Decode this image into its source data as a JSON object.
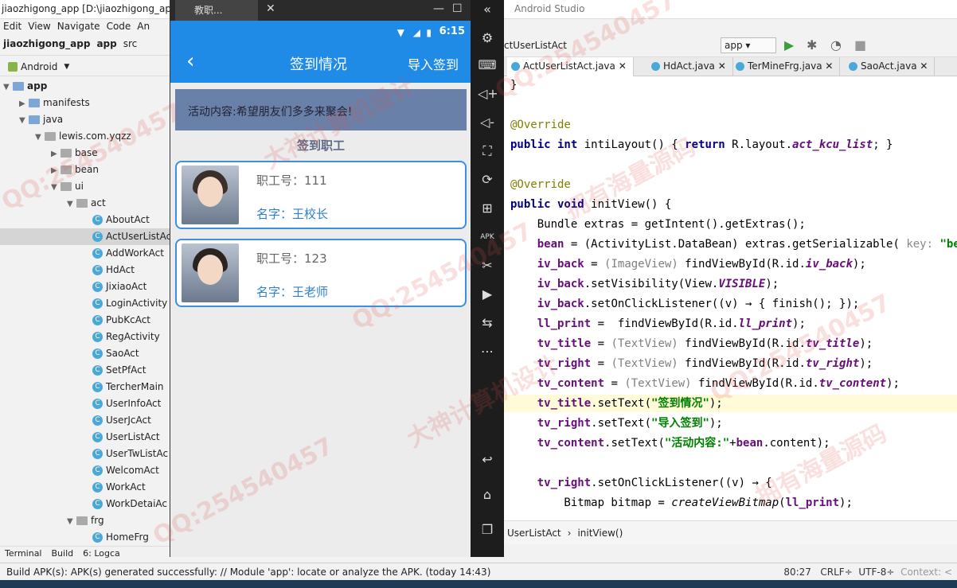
{
  "window": {
    "project_title": "jiaozhigong_app [D:\\jiaozhigong_app]",
    "studio_title": "Android Studio"
  },
  "menu": [
    "Edit",
    "View",
    "Navigate",
    "Code",
    "An"
  ],
  "breadcrumb": [
    "jiaozhigong_app",
    "app",
    "src"
  ],
  "project_view": {
    "mode": "Android"
  },
  "tree": [
    {
      "label": "app",
      "indent": 0,
      "kind": "folder-bold",
      "arrow": "▼"
    },
    {
      "label": "manifests",
      "indent": 1,
      "kind": "folder",
      "arrow": "▶"
    },
    {
      "label": "java",
      "indent": 1,
      "kind": "folder",
      "arrow": "▼"
    },
    {
      "label": "lewis.com.yqzz",
      "indent": 2,
      "kind": "folder-grey",
      "arrow": "▼"
    },
    {
      "label": "base",
      "indent": 3,
      "kind": "folder-grey",
      "arrow": "▶"
    },
    {
      "label": "bean",
      "indent": 3,
      "kind": "folder-grey",
      "arrow": "▶"
    },
    {
      "label": "ui",
      "indent": 3,
      "kind": "folder-grey",
      "arrow": "▼"
    },
    {
      "label": "act",
      "indent": 4,
      "kind": "folder-grey",
      "arrow": "▼"
    },
    {
      "label": "AboutAct",
      "indent": 5,
      "kind": "class"
    },
    {
      "label": "ActUserListAct",
      "indent": 5,
      "kind": "class",
      "selected": true
    },
    {
      "label": "AddWorkAct",
      "indent": 5,
      "kind": "class"
    },
    {
      "label": "HdAct",
      "indent": 5,
      "kind": "class"
    },
    {
      "label": "JixiaoAct",
      "indent": 5,
      "kind": "class"
    },
    {
      "label": "LoginActivity",
      "indent": 5,
      "kind": "class"
    },
    {
      "label": "PubKcAct",
      "indent": 5,
      "kind": "class"
    },
    {
      "label": "RegActivity",
      "indent": 5,
      "kind": "class"
    },
    {
      "label": "SaoAct",
      "indent": 5,
      "kind": "class"
    },
    {
      "label": "SetPfAct",
      "indent": 5,
      "kind": "class"
    },
    {
      "label": "TercherMain",
      "indent": 5,
      "kind": "class"
    },
    {
      "label": "UserInfoAct",
      "indent": 5,
      "kind": "class"
    },
    {
      "label": "UserJcAct",
      "indent": 5,
      "kind": "class"
    },
    {
      "label": "UserListAct",
      "indent": 5,
      "kind": "class"
    },
    {
      "label": "UserTwListAc",
      "indent": 5,
      "kind": "class"
    },
    {
      "label": "WelcomAct",
      "indent": 5,
      "kind": "class"
    },
    {
      "label": "WorkAct",
      "indent": 5,
      "kind": "class"
    },
    {
      "label": "WorkDetaiAc",
      "indent": 5,
      "kind": "class"
    },
    {
      "label": "frg",
      "indent": 4,
      "kind": "folder-grey",
      "arrow": "▼"
    },
    {
      "label": "HomeFrg",
      "indent": 5,
      "kind": "class"
    }
  ],
  "bottom_tabs": [
    "Terminal",
    "Build",
    "6: Logca"
  ],
  "status": {
    "message": "Build APK(s): APK(s) generated successfully: // Module 'app': locate or analyze the APK. (today 14:43)",
    "position": "80:27",
    "line_sep": "CRLF÷",
    "encoding": "UTF-8÷",
    "context": "Context: <"
  },
  "emulator": {
    "tab": "教职...",
    "time": "6:15",
    "app_title": "签到情况",
    "app_right": "导入签到",
    "banner": "活动内容:希望朋友们多多来聚会!",
    "section": "签到职工",
    "staff": [
      {
        "num": "职工号：111",
        "name": "名字：王校长"
      },
      {
        "num": "职工号：123",
        "name": "名字：王老师"
      }
    ]
  },
  "editor": {
    "crumb": "ctUserListAct",
    "run_config": "app",
    "tabs": [
      "ActUserListAct.java",
      "HdAct.java",
      "TerMineFrg.java",
      "SaoAct.java"
    ],
    "bottom_crumbs": [
      "UserListAct",
      "initView()"
    ]
  },
  "watermark": [
    "QQ:254540457",
    "大神计算机设计",
    "拥有海量源码"
  ]
}
